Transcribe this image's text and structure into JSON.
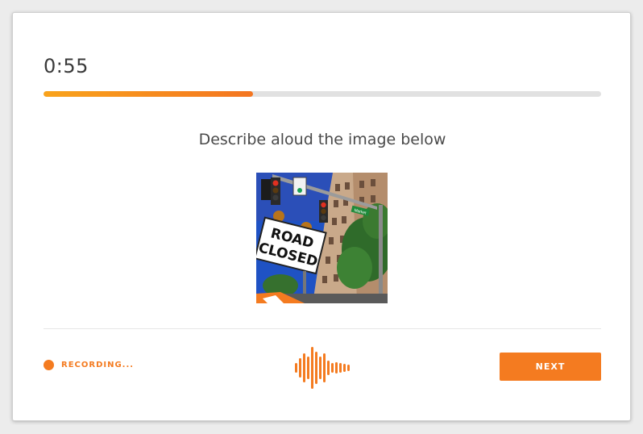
{
  "timer": {
    "value": "0:55",
    "progress": 0.375
  },
  "prompt": {
    "text": "Describe aloud the image below"
  },
  "photo": {
    "sign_line1": "ROAD",
    "sign_line2": "CLOSED",
    "street_sign": "Market"
  },
  "recording": {
    "label": "RECORDING..."
  },
  "actions": {
    "next_label": "NEXT"
  },
  "colors": {
    "accent": "#f47b20",
    "progress_start": "#f9a31b",
    "track": "#e1e1e1",
    "text": "#3a3a3a"
  }
}
